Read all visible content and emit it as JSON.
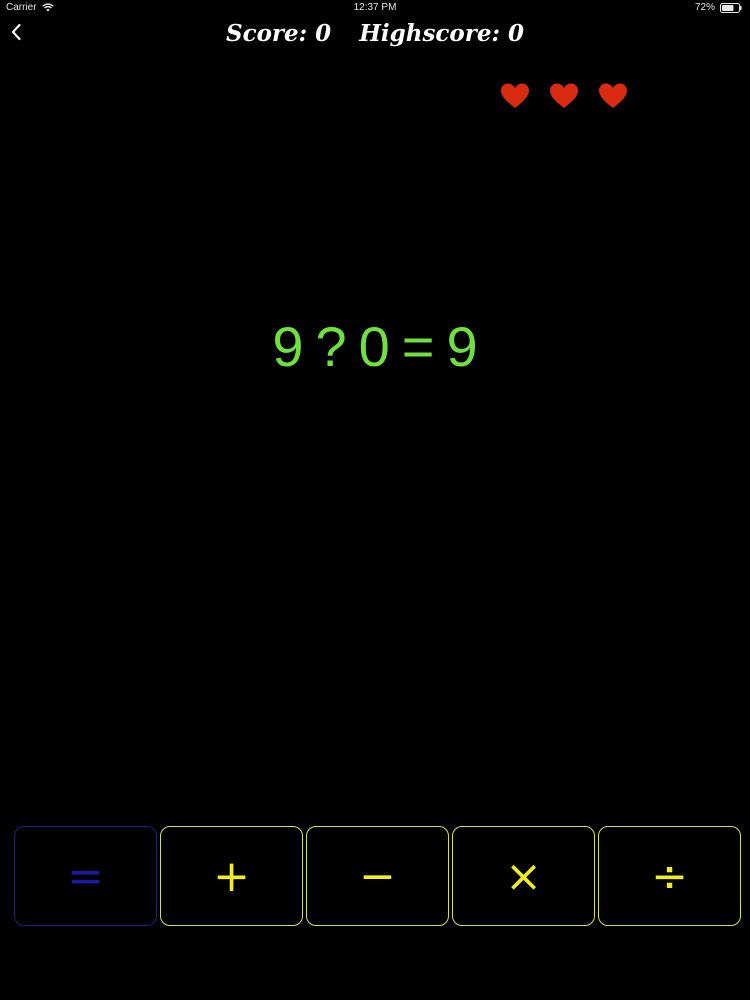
{
  "status_bar": {
    "carrier": "Carrier",
    "time": "12:37 PM",
    "battery": "72%",
    "battery_level": 0.72
  },
  "header": {
    "score_label": "Score: 0",
    "highscore_label": "Highscore: 0",
    "lives": 3
  },
  "equation": {
    "left_operand": "9",
    "unknown": "?",
    "right_operand": "0",
    "equals": "=",
    "result": "9"
  },
  "operators": [
    {
      "label": "=",
      "selected": true
    },
    {
      "label": "+",
      "selected": false
    },
    {
      "label": "−",
      "selected": false
    },
    {
      "label": "×",
      "selected": false
    },
    {
      "label": "÷",
      "selected": false
    }
  ],
  "colors": {
    "background": "#000000",
    "equation": "#6fe040",
    "button_border": "#e0dd49",
    "button_text": "#f2ef1f",
    "selected": "#1a1aa8",
    "heart": "#d92a12"
  }
}
